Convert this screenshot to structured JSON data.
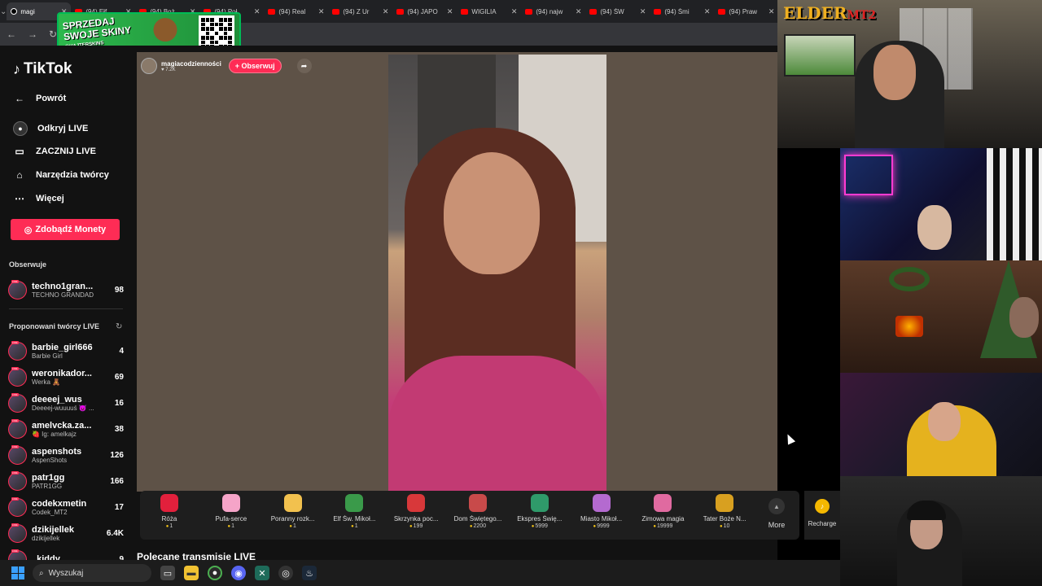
{
  "browser": {
    "tabs": [
      {
        "label": "magi",
        "active": true,
        "kind": "tiktok"
      },
      {
        "label": "(94) Ełf",
        "kind": "yt"
      },
      {
        "label": "(94) Boż",
        "kind": "yt"
      },
      {
        "label": "(94) Poł",
        "kind": "yt"
      },
      {
        "label": "(94) Real",
        "kind": "yt"
      },
      {
        "label": "(94) Z Ur",
        "kind": "yt"
      },
      {
        "label": "(94) JAPO",
        "kind": "yt"
      },
      {
        "label": "WIGILIA",
        "kind": "yt"
      },
      {
        "label": "(94) najw",
        "kind": "yt"
      },
      {
        "label": "(94) ŚW",
        "kind": "yt"
      },
      {
        "label": "(94) Śmi",
        "kind": "yt"
      },
      {
        "label": "(94) Praw",
        "kind": "yt"
      }
    ],
    "banner": {
      "line1": "SPRZEDAJ",
      "line2": "SWOJE SKINY",
      "handle": "@HAJTERSKINS"
    }
  },
  "sidebar": {
    "logo": "TikTok",
    "nav": [
      {
        "label": "Powrót",
        "icon": "back-arrow-icon"
      },
      {
        "label": "Odkryj LIVE",
        "icon": "live-icon"
      },
      {
        "label": "ZACZNIJ LIVE",
        "icon": "camera-icon"
      },
      {
        "label": "Narzędzia twórcy",
        "icon": "home-icon"
      },
      {
        "label": "Więcej",
        "icon": "more-dots-icon"
      }
    ],
    "coins_button": "Zdobądź Monety",
    "following_title": "Obserwuje",
    "following": [
      {
        "name": "techno1gran...",
        "sub": "TECHNO GRANDAD",
        "count": "98"
      }
    ],
    "suggested_title": "Proponowani twórcy LIVE",
    "suggested": [
      {
        "name": "barbie_girl666",
        "sub": "Barbie Girl",
        "count": "4"
      },
      {
        "name": "weronikador...",
        "sub": "Werka 🧸",
        "count": "69"
      },
      {
        "name": "deeeej_wus",
        "sub": "Deeeej-wuuuuś 😈 ...",
        "count": "16"
      },
      {
        "name": "amelvcka.za...",
        "sub": "🍓 Ig: amelkajz",
        "count": "38"
      },
      {
        "name": "aspenshots",
        "sub": "AspenShots",
        "count": "126"
      },
      {
        "name": "patr1gg",
        "sub": "PATR1GG",
        "count": "166"
      },
      {
        "name": "codekxmetin",
        "sub": "Codek_MT2",
        "count": "17"
      },
      {
        "name": "dzikijellek",
        "sub": "dzikijellek",
        "count": "6.4K"
      },
      {
        "name": "..kiddy",
        "sub": "",
        "count": "9"
      }
    ]
  },
  "live": {
    "host_name": "magiacodzienności",
    "host_likes": "♥ 7.2K",
    "follow_label": "+ Obserwuj",
    "gifts": [
      {
        "name": "Róża",
        "price": "1",
        "color": "#e2203c"
      },
      {
        "name": "Pufa-serce",
        "price": "1",
        "color": "#f5a4c8"
      },
      {
        "name": "Poranny rozk...",
        "price": "1",
        "color": "#f2c14e"
      },
      {
        "name": "Elf Św. Mikoł...",
        "price": "1",
        "color": "#3a9a4a"
      },
      {
        "name": "Skrzynka poc...",
        "price": "199",
        "color": "#d8383a"
      },
      {
        "name": "Dom Świętego...",
        "price": "2200",
        "color": "#c84a4a"
      },
      {
        "name": "Ekspres Świę...",
        "price": "5999",
        "color": "#2f9a6a"
      },
      {
        "name": "Miasto Mikoł...",
        "price": "9999",
        "color": "#b46ad0"
      },
      {
        "name": "Zimowa magia",
        "price": "19999",
        "color": "#e06aa0"
      },
      {
        "name": "Tater Boże N...",
        "price": "10",
        "color": "#d8a020"
      }
    ],
    "more_label": "More",
    "recharge_label": "Recharge",
    "recommended_title": "Polecane transmisje LIVE"
  },
  "overlay": {
    "brand": "ELDER",
    "brand_suffix": "MT2"
  },
  "taskbar": {
    "search_placeholder": "Wyszukaj",
    "discord_badge": "99"
  }
}
